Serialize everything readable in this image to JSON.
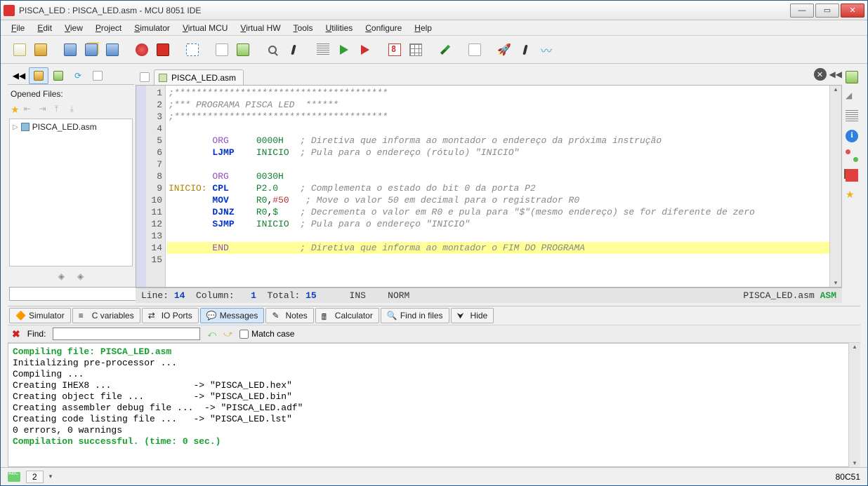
{
  "window": {
    "title": "PISCA_LED : PISCA_LED.asm - MCU 8051 IDE"
  },
  "menu": [
    "File",
    "Edit",
    "View",
    "Project",
    "Simulator",
    "Virtual MCU",
    "Virtual HW",
    "Tools",
    "Utilities",
    "Configure",
    "Help"
  ],
  "left_panel": {
    "label": "Opened Files:",
    "files": [
      "PISCA_LED.asm"
    ]
  },
  "editor": {
    "tab": "PISCA_LED.asm",
    "highlight_line": 14,
    "lines": [
      {
        "n": 1,
        "html": "<span class='c-comment'>;***************************************</span>"
      },
      {
        "n": 2,
        "html": "<span class='c-comment'>;*** PROGRAMA PISCA LED  ******</span>"
      },
      {
        "n": 3,
        "html": "<span class='c-comment'>;***************************************</span>"
      },
      {
        "n": 4,
        "html": ""
      },
      {
        "n": 5,
        "html": "        <span class='c-dir'>ORG</span>     <span class='c-num'>0000H</span>   <span class='c-comment'>; Diretiva que informa ao montador o endereço da próxima instrução</span>"
      },
      {
        "n": 6,
        "html": "        <span class='c-mnem'>LJMP</span>    <span class='c-op'>INICIO</span>  <span class='c-comment'>; Pula para o endereço (rótulo) \"INICIO\"</span>"
      },
      {
        "n": 7,
        "html": ""
      },
      {
        "n": 8,
        "html": "        <span class='c-dir'>ORG</span>     <span class='c-num'>0030H</span>"
      },
      {
        "n": 9,
        "html": "<span class='c-label'>INICIO:</span> <span class='c-mnem'>CPL</span>     <span class='c-op'>P2.0</span>    <span class='c-comment'>; Complementa o estado do bit 0 da porta P2</span>"
      },
      {
        "n": 10,
        "html": "        <span class='c-mnem'>MOV</span>     <span class='c-op'>R0</span>,<span class='c-red'>#50</span>   <span class='c-comment'>; Move o valor 50 em decimal para o registrador R0</span>"
      },
      {
        "n": 11,
        "html": "        <span class='c-mnem'>DJNZ</span>    <span class='c-op'>R0</span>,<span class='c-op'>$</span>    <span class='c-comment'>; Decrementa o valor em R0 e pula para \"$\"(mesmo endereço) se for diferente de zero</span>"
      },
      {
        "n": 12,
        "html": "        <span class='c-mnem'>SJMP</span>    <span class='c-op'>INICIO</span>  <span class='c-comment'>; Pula para o endereço \"INICIO\"</span>"
      },
      {
        "n": 13,
        "html": ""
      },
      {
        "n": 14,
        "html": "        <span class='c-dir'>END</span>             <span class='c-comment'>; Diretiva que informa ao montador o FIM DO PROGRAMA</span>"
      },
      {
        "n": 15,
        "html": ""
      }
    ]
  },
  "status": {
    "line_lbl": "Line:",
    "line": "14",
    "col_lbl": "Column:",
    "col": "1",
    "tot_lbl": "Total:",
    "tot": "15",
    "ins": "INS",
    "norm": "NORM",
    "file": "PISCA_LED.asm",
    "lang": "ASM"
  },
  "bottom_tabs": [
    "Simulator",
    "C variables",
    "IO Ports",
    "Messages",
    "Notes",
    "Calculator",
    "Find in files",
    "Hide"
  ],
  "bottom_active": 3,
  "find": {
    "label": "Find:",
    "match": "Match case"
  },
  "messages": [
    {
      "cls": "msg-green",
      "text": "Compiling file: PISCA_LED.asm"
    },
    {
      "cls": "",
      "text": "Initializing pre-processor ..."
    },
    {
      "cls": "",
      "text": "Compiling ..."
    },
    {
      "cls": "",
      "text": "Creating IHEX8 ...               -> \"PISCA_LED.hex\""
    },
    {
      "cls": "",
      "text": "Creating object file ...         -> \"PISCA_LED.bin\""
    },
    {
      "cls": "",
      "text": "Creating assembler debug file ...  -> \"PISCA_LED.adf\""
    },
    {
      "cls": "",
      "text": "Creating code listing file ...   -> \"PISCA_LED.lst\""
    },
    {
      "cls": "",
      "text": "0 errors, 0 warnings"
    },
    {
      "cls": "msg-green",
      "text": "Compilation successful. (time: 0 sec.)"
    }
  ],
  "footer": {
    "count": "2",
    "mcu": "80C51"
  }
}
